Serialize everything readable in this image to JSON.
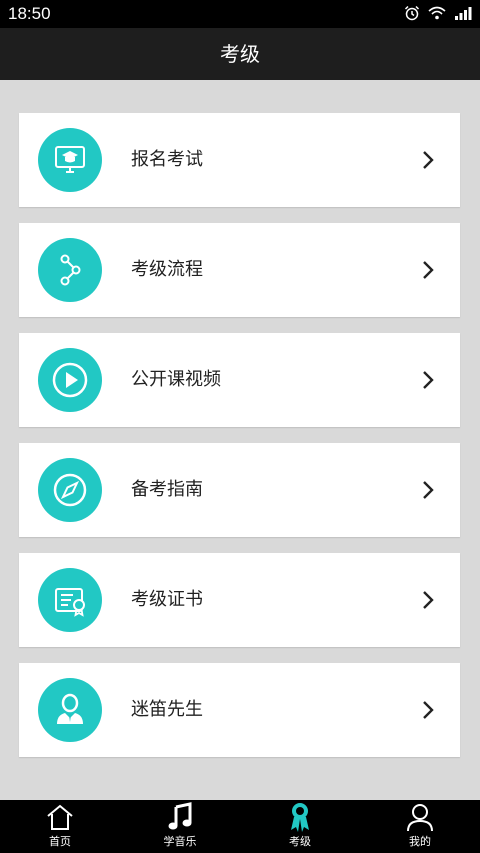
{
  "status_bar": {
    "time": "18:50"
  },
  "title": "考级",
  "menu": [
    {
      "label": "报名考试",
      "icon": "monitor-graduation-cap-icon"
    },
    {
      "label": "考级流程",
      "icon": "flow-nodes-icon"
    },
    {
      "label": "公开课视频",
      "icon": "play-icon"
    },
    {
      "label": "备考指南",
      "icon": "compass-icon"
    },
    {
      "label": "考级证书",
      "icon": "certificate-icon"
    },
    {
      "label": "迷笛先生",
      "icon": "person-icon"
    }
  ],
  "tabs": [
    {
      "label": "首页",
      "icon": "home-icon"
    },
    {
      "label": "学音乐",
      "icon": "music-note-icon"
    },
    {
      "label": "考级",
      "icon": "ribbon-icon",
      "active": true
    },
    {
      "label": "我的",
      "icon": "user-icon"
    }
  ],
  "colors": {
    "accent": "#22c8c4",
    "header": "#1e1e1e",
    "background": "#d9d9d9"
  }
}
